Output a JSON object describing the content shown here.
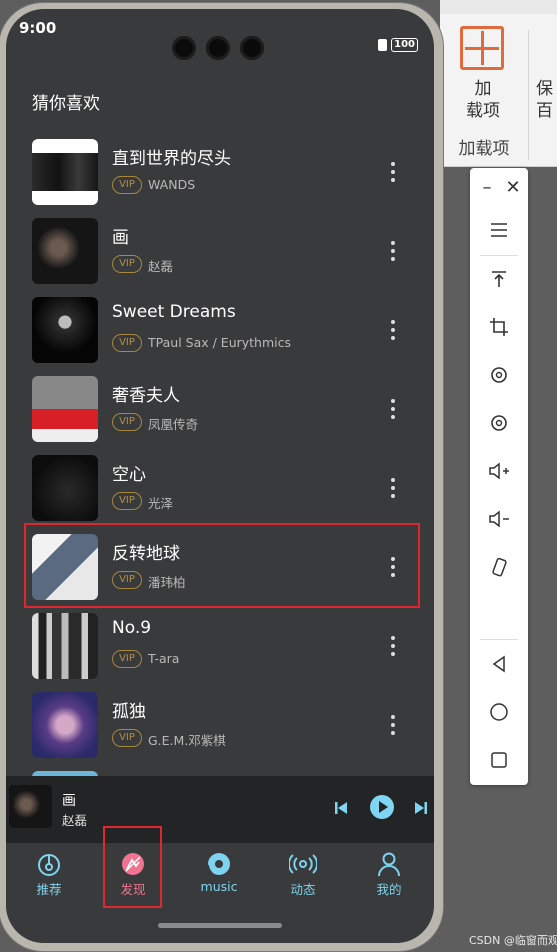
{
  "desktop": {
    "ribbon": {
      "button_label": "加载项",
      "button_label_line1": "加",
      "button_label_line2": "载项",
      "group_label": "加载项",
      "partial_label_line1": "保",
      "partial_label_line2": "百"
    }
  },
  "status_bar": {
    "time": "9:00",
    "battery": "100"
  },
  "section": {
    "title": "猜你喜欢"
  },
  "songs": [
    {
      "title": "直到世界的尽头",
      "vip": "VIP",
      "artist": "WANDS"
    },
    {
      "title": "画",
      "vip": "VIP",
      "artist": "赵磊"
    },
    {
      "title": "Sweet Dreams",
      "vip": "VIP",
      "artist": "TPaul Sax / Eurythmics"
    },
    {
      "title": "奢香夫人",
      "vip": "VIP",
      "artist": "凤凰传奇"
    },
    {
      "title": "空心",
      "vip": "VIP",
      "artist": "光泽"
    },
    {
      "title": "反转地球",
      "vip": "VIP",
      "artist": "潘玮柏"
    },
    {
      "title": "No.9",
      "vip": "VIP",
      "artist": "T-ara"
    },
    {
      "title": "孤独",
      "vip": "VIP",
      "artist": "G.E.M.邓紫棋"
    }
  ],
  "player": {
    "title": "画",
    "artist": "赵磊"
  },
  "tabs": [
    {
      "label": "推荐",
      "icon": "recommend-icon"
    },
    {
      "label": "发现",
      "icon": "discover-icon"
    },
    {
      "label": "music",
      "icon": "music-icon"
    },
    {
      "label": "动态",
      "icon": "broadcast-icon"
    },
    {
      "label": "我的",
      "icon": "user-icon"
    }
  ],
  "colors": {
    "accent": "#7ed3ef",
    "active_tab": "#f0748f",
    "highlight_box": "#e0262e",
    "vip": "#b38f45",
    "screen_bg": "#393a3c"
  },
  "watermark": "CSDN @临窗而观"
}
